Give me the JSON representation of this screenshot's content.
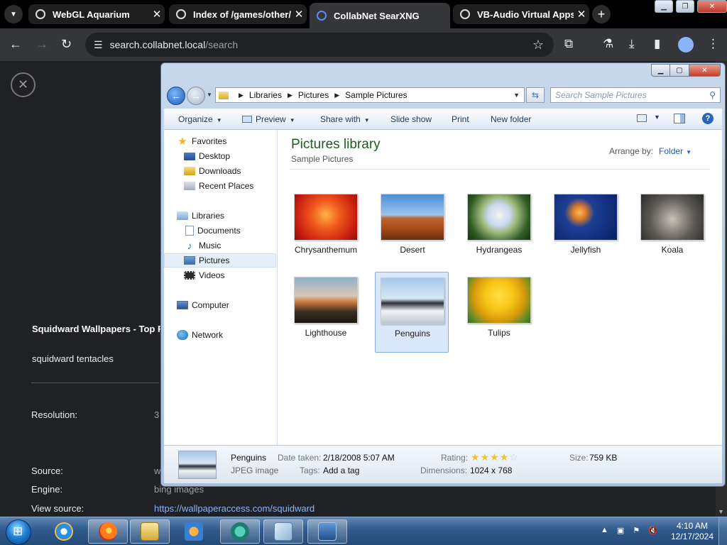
{
  "browser": {
    "tabs": [
      {
        "label": "WebGL Aquarium",
        "active": false
      },
      {
        "label": "Index of /games/other/",
        "active": false
      },
      {
        "label": "CollabNet SearXNG",
        "active": true
      },
      {
        "label": "VB-Audio Virtual Apps",
        "active": false
      }
    ],
    "url_domain": "search.collabnet.local",
    "url_path": "/search"
  },
  "page": {
    "title": "Squidward Wallpapers - Top F",
    "subtitle": "squidward tentacles",
    "rows": [
      {
        "label": "Resolution:",
        "value": "3"
      },
      {
        "label": "Source:",
        "value": "w"
      },
      {
        "label": "Engine:",
        "value": "bing images"
      },
      {
        "label": "View source:",
        "value": "https://wallpaperaccess.com/squidward"
      }
    ]
  },
  "explorer": {
    "breadcrumb": [
      "Libraries",
      "Pictures",
      "Sample Pictures"
    ],
    "search_placeholder": "Search Sample Pictures",
    "toolbar": {
      "organize": "Organize",
      "preview": "Preview",
      "share": "Share with",
      "slideshow": "Slide show",
      "print": "Print",
      "newfolder": "New folder"
    },
    "nav": {
      "favorites": "Favorites",
      "desktop": "Desktop",
      "downloads": "Downloads",
      "recent": "Recent Places",
      "libraries": "Libraries",
      "documents": "Documents",
      "music": "Music",
      "pictures": "Pictures",
      "videos": "Videos",
      "computer": "Computer",
      "network": "Network"
    },
    "library_title": "Pictures library",
    "library_sub": "Sample Pictures",
    "arrange_label": "Arrange by:",
    "arrange_value": "Folder",
    "files": [
      {
        "name": "Chrysanthemum"
      },
      {
        "name": "Desert"
      },
      {
        "name": "Hydrangeas"
      },
      {
        "name": "Jellyfish"
      },
      {
        "name": "Koala"
      },
      {
        "name": "Lighthouse"
      },
      {
        "name": "Penguins",
        "selected": true
      },
      {
        "name": "Tulips"
      }
    ],
    "details": {
      "name": "Penguins",
      "type": "JPEG image",
      "date_label": "Date taken:",
      "date_value": "2/18/2008 5:07 AM",
      "tags_label": "Tags:",
      "tags_value": "Add a tag",
      "rating_label": "Rating:",
      "rating": 4,
      "rating_max": 5,
      "dims_label": "Dimensions:",
      "dims_value": "1024 x 768",
      "size_label": "Size:",
      "size_value": "759 KB"
    }
  },
  "taskbar": {
    "time": "4:10 AM",
    "date": "12/17/2024"
  }
}
